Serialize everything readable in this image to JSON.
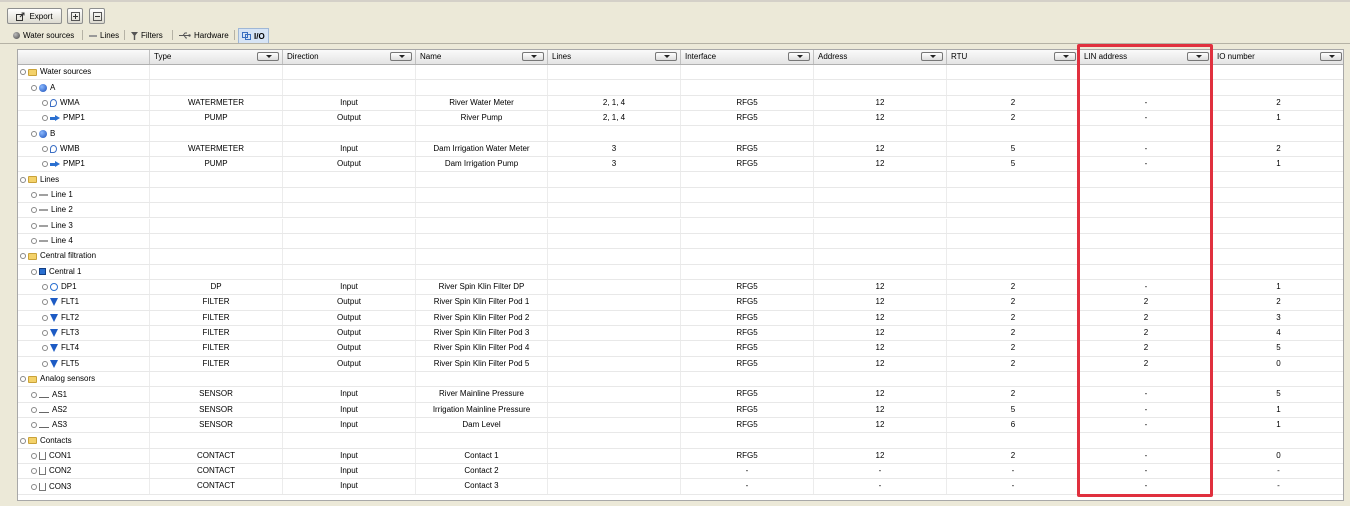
{
  "toolbar": {
    "export_label": "Export"
  },
  "tabs": [
    {
      "label": "Water sources",
      "icon": "water-source-icon"
    },
    {
      "label": "Lines",
      "icon": "line-icon"
    },
    {
      "label": "Filters",
      "icon": "filter-icon"
    },
    {
      "label": "Hardware",
      "icon": "usb-icon"
    },
    {
      "label": "I/O",
      "icon": "io-icon",
      "selected": true
    }
  ],
  "columns": [
    "Type",
    "Direction",
    "Name",
    "Lines",
    "Interface",
    "Address",
    "RTU",
    "LIN address",
    "IO number"
  ],
  "rows": [
    {
      "label": "Water sources",
      "level": 0,
      "icon": "folder-icon",
      "cells": [
        "",
        "",
        "",
        "",
        "",
        "",
        "",
        "",
        ""
      ]
    },
    {
      "label": "A",
      "level": 1,
      "icon": "water-source-icon",
      "cells": [
        "",
        "",
        "",
        "",
        "",
        "",
        "",
        "",
        ""
      ]
    },
    {
      "label": "WMA",
      "level": 2,
      "icon": "watermeter-icon",
      "cells": [
        "WATERMETER",
        "Input",
        "River Water Meter",
        "2, 1, 4",
        "RFG5",
        "12",
        "2",
        "-",
        "2"
      ]
    },
    {
      "label": "PMP1",
      "level": 2,
      "icon": "pump-icon",
      "cells": [
        "PUMP",
        "Output",
        "River Pump",
        "2, 1, 4",
        "RFG5",
        "12",
        "2",
        "-",
        "1"
      ]
    },
    {
      "label": "B",
      "level": 1,
      "icon": "water-source-icon",
      "cells": [
        "",
        "",
        "",
        "",
        "",
        "",
        "",
        "",
        ""
      ]
    },
    {
      "label": "WMB",
      "level": 2,
      "icon": "watermeter-icon",
      "cells": [
        "WATERMETER",
        "Input",
        "Dam Irrigation Water Meter",
        "3",
        "RFG5",
        "12",
        "5",
        "-",
        "2"
      ]
    },
    {
      "label": "PMP1",
      "level": 2,
      "icon": "pump-icon",
      "cells": [
        "PUMP",
        "Output",
        "Dam Irrigation Pump",
        "3",
        "RFG5",
        "12",
        "5",
        "-",
        "1"
      ]
    },
    {
      "label": "Lines",
      "level": 0,
      "icon": "folder-icon",
      "cells": [
        "",
        "",
        "",
        "",
        "",
        "",
        "",
        "",
        ""
      ]
    },
    {
      "label": "Line 1",
      "level": 1,
      "icon": "line-icon",
      "cells": [
        "",
        "",
        "",
        "",
        "",
        "",
        "",
        "",
        ""
      ]
    },
    {
      "label": "Line 2",
      "level": 1,
      "icon": "line-icon",
      "cells": [
        "",
        "",
        "",
        "",
        "",
        "",
        "",
        "",
        ""
      ]
    },
    {
      "label": "Line 3",
      "level": 1,
      "icon": "line-icon",
      "cells": [
        "",
        "",
        "",
        "",
        "",
        "",
        "",
        "",
        ""
      ]
    },
    {
      "label": "Line 4",
      "level": 1,
      "icon": "line-icon",
      "cells": [
        "",
        "",
        "",
        "",
        "",
        "",
        "",
        "",
        ""
      ]
    },
    {
      "label": "Central filtration",
      "level": 0,
      "icon": "folder-icon",
      "cells": [
        "",
        "",
        "",
        "",
        "",
        "",
        "",
        "",
        ""
      ]
    },
    {
      "label": "Central 1",
      "level": 1,
      "icon": "central-icon",
      "cells": [
        "",
        "",
        "",
        "",
        "",
        "",
        "",
        "",
        ""
      ]
    },
    {
      "label": "DP1",
      "level": 2,
      "icon": "dp-icon",
      "cells": [
        "DP",
        "Input",
        "River Spin Klin Filter DP",
        "",
        "RFG5",
        "12",
        "2",
        "-",
        "1"
      ]
    },
    {
      "label": "FLT1",
      "level": 2,
      "icon": "filter-icon",
      "cells": [
        "FILTER",
        "Output",
        "River Spin Klin Filter Pod 1",
        "",
        "RFG5",
        "12",
        "2",
        "2",
        "2"
      ]
    },
    {
      "label": "FLT2",
      "level": 2,
      "icon": "filter-icon",
      "cells": [
        "FILTER",
        "Output",
        "River Spin Klin Filter Pod 2",
        "",
        "RFG5",
        "12",
        "2",
        "2",
        "3"
      ]
    },
    {
      "label": "FLT3",
      "level": 2,
      "icon": "filter-icon",
      "cells": [
        "FILTER",
        "Output",
        "River Spin Klin Filter Pod 3",
        "",
        "RFG5",
        "12",
        "2",
        "2",
        "4"
      ]
    },
    {
      "label": "FLT4",
      "level": 2,
      "icon": "filter-icon",
      "cells": [
        "FILTER",
        "Output",
        "River Spin Klin Filter Pod 4",
        "",
        "RFG5",
        "12",
        "2",
        "2",
        "5"
      ]
    },
    {
      "label": "FLT5",
      "level": 2,
      "icon": "filter-icon",
      "cells": [
        "FILTER",
        "Output",
        "River Spin Klin Filter Pod 5",
        "",
        "RFG5",
        "12",
        "2",
        "2",
        "0"
      ]
    },
    {
      "label": "Analog sensors",
      "level": 0,
      "icon": "folder-icon",
      "cells": [
        "",
        "",
        "",
        "",
        "",
        "",
        "",
        "",
        ""
      ]
    },
    {
      "label": "AS1",
      "level": 1,
      "icon": "sensor-icon",
      "cells": [
        "SENSOR",
        "Input",
        "River Mainline Pressure",
        "",
        "RFG5",
        "12",
        "2",
        "-",
        "5"
      ]
    },
    {
      "label": "AS2",
      "level": 1,
      "icon": "sensor-icon",
      "cells": [
        "SENSOR",
        "Input",
        "Irrigation Mainline Pressure",
        "",
        "RFG5",
        "12",
        "5",
        "-",
        "1"
      ]
    },
    {
      "label": "AS3",
      "level": 1,
      "icon": "sensor-icon",
      "cells": [
        "SENSOR",
        "Input",
        "Dam Level",
        "",
        "RFG5",
        "12",
        "6",
        "-",
        "1"
      ]
    },
    {
      "label": "Contacts",
      "level": 0,
      "icon": "folder-icon",
      "cells": [
        "",
        "",
        "",
        "",
        "",
        "",
        "",
        "",
        ""
      ]
    },
    {
      "label": "CON1",
      "level": 1,
      "icon": "contact-icon",
      "cells": [
        "CONTACT",
        "Input",
        "Contact 1",
        "",
        "RFG5",
        "12",
        "2",
        "-",
        "0"
      ]
    },
    {
      "label": "CON2",
      "level": 1,
      "icon": "contact-icon",
      "cells": [
        "CONTACT",
        "Input",
        "Contact 2",
        "",
        "-",
        "-",
        "-",
        "-",
        "-"
      ]
    },
    {
      "label": "CON3",
      "level": 1,
      "icon": "contact-icon",
      "cells": [
        "CONTACT",
        "Input",
        "Contact 3",
        "",
        "-",
        "-",
        "-",
        "-",
        "-"
      ]
    }
  ],
  "colors": {
    "highlight": "#e0303e",
    "selected_tab": "#d6e4f5"
  }
}
